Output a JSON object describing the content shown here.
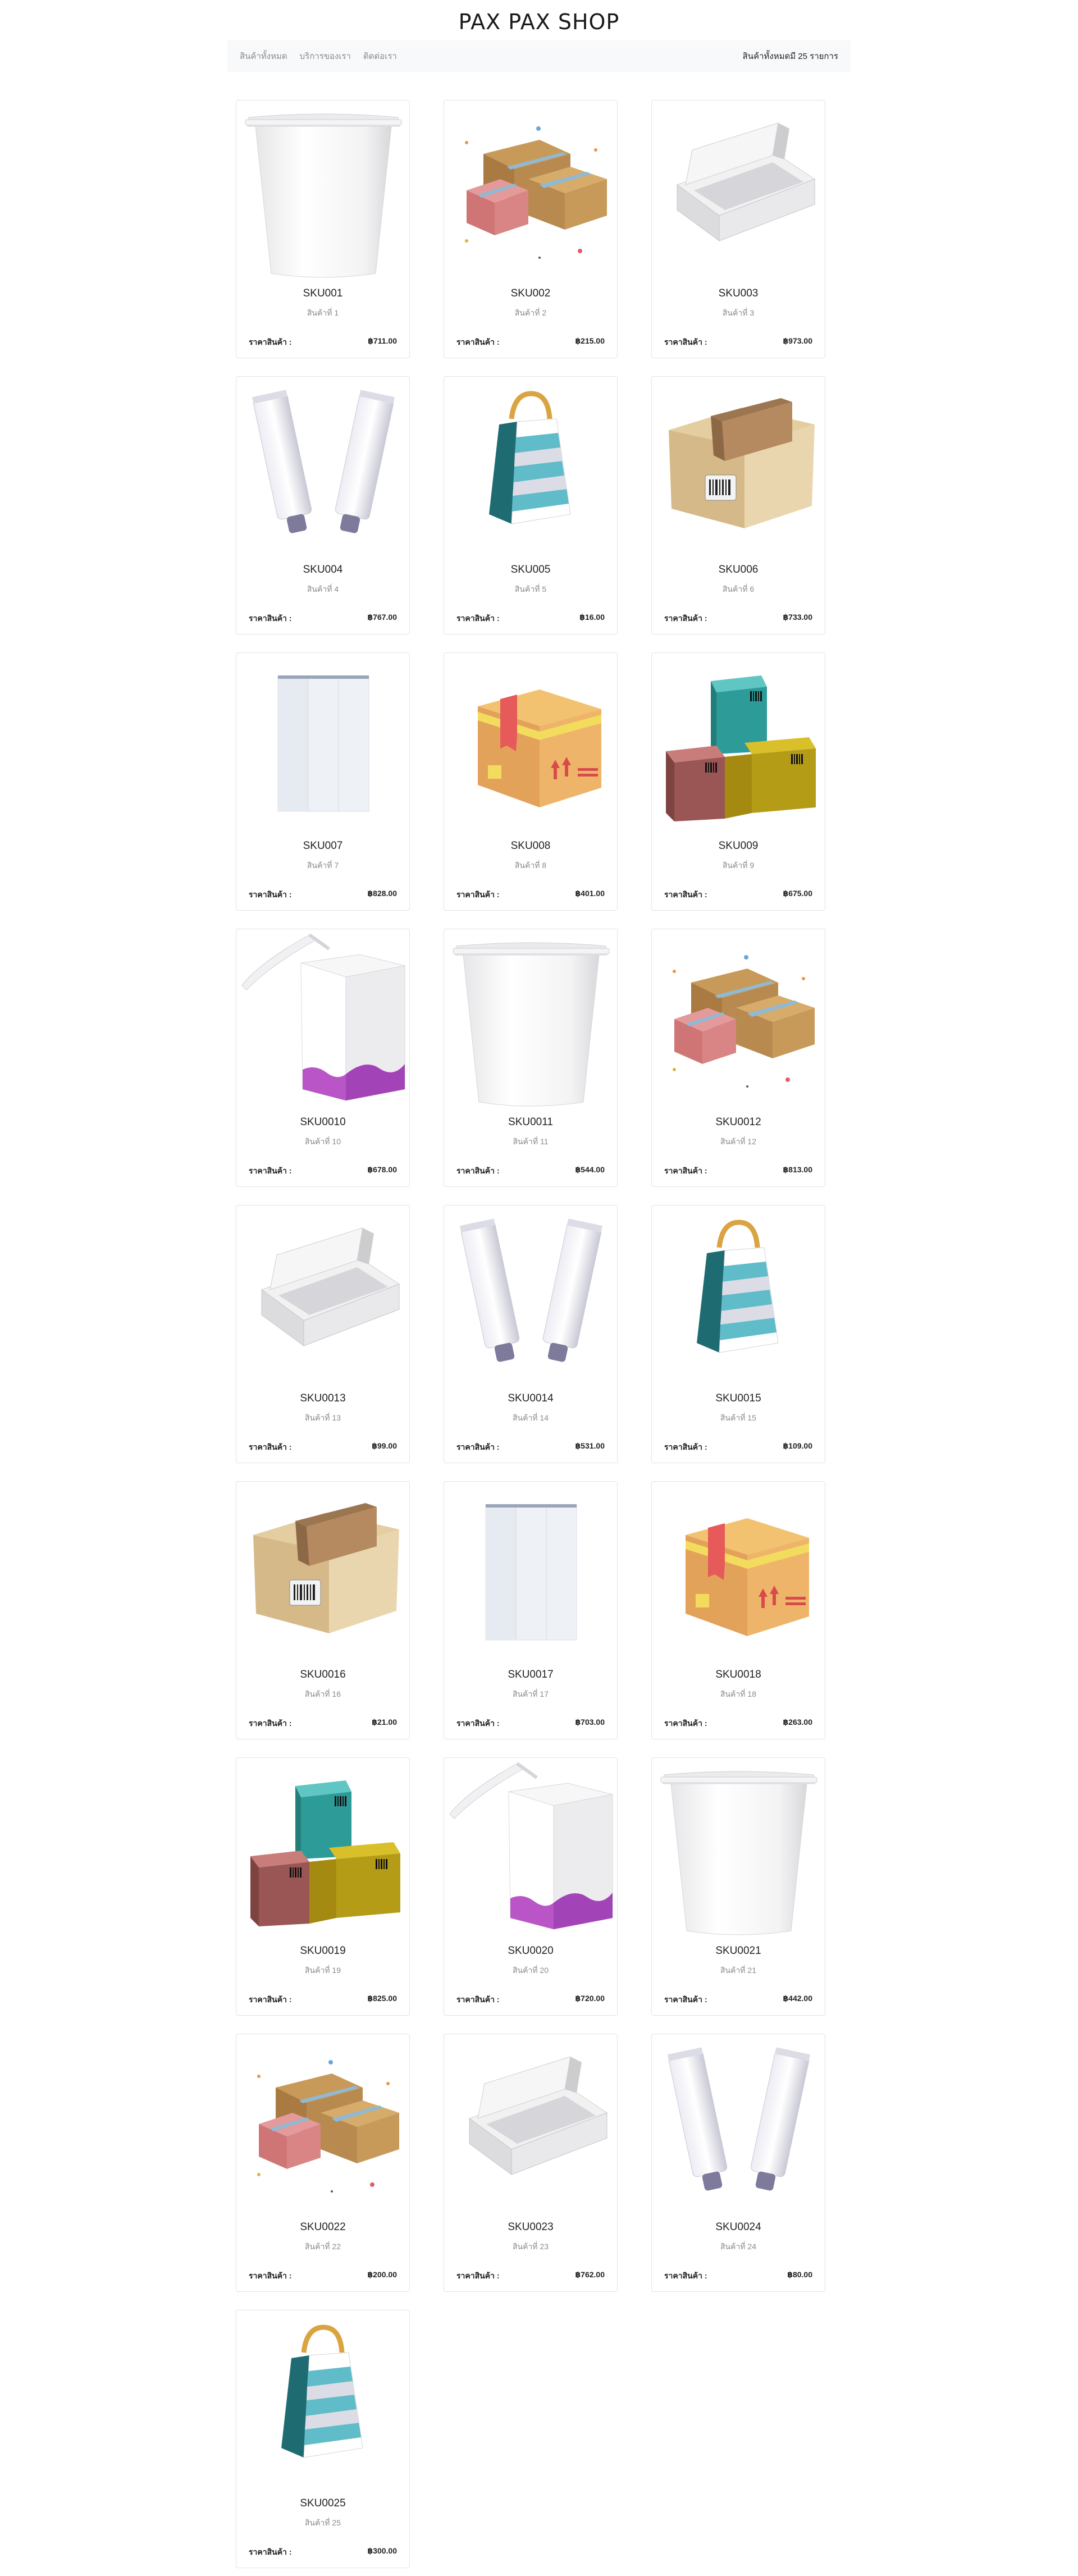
{
  "site": {
    "title": "PAX PAX SHOP"
  },
  "nav": {
    "links": [
      "สินค้าทั้งหมด",
      "บริการของเรา",
      "ติดต่อเรา"
    ],
    "total_text": "สินค้าทั้งหมดมี 25 รายการ"
  },
  "price_label": "ราคาสินค้า :",
  "products": [
    {
      "sku": "SKU001",
      "name": "สินค้าที่ 1",
      "price": "฿711.00",
      "image": "paper-cup"
    },
    {
      "sku": "SKU002",
      "name": "สินค้าที่ 2",
      "price": "฿215.00",
      "image": "parcel-boxes"
    },
    {
      "sku": "SKU003",
      "name": "สินค้าที่ 3",
      "price": "฿973.00",
      "image": "open-white-box"
    },
    {
      "sku": "SKU004",
      "name": "สินค้าที่ 4",
      "price": "฿767.00",
      "image": "tubes"
    },
    {
      "sku": "SKU005",
      "name": "สินค้าที่ 5",
      "price": "฿16.00",
      "image": "shopping-bag"
    },
    {
      "sku": "SKU006",
      "name": "สินค้าที่ 6",
      "price": "฿733.00",
      "image": "cardboard-box-barcode"
    },
    {
      "sku": "SKU007",
      "name": "สินค้าที่ 7",
      "price": "฿828.00",
      "image": "white-carton"
    },
    {
      "sku": "SKU008",
      "name": "สินค้าที่ 8",
      "price": "฿401.00",
      "image": "shipping-box"
    },
    {
      "sku": "SKU009",
      "name": "สินค้าที่ 9",
      "price": "฿675.00",
      "image": "stacked-colored-boxes"
    },
    {
      "sku": "SKU0010",
      "name": "สินค้าที่ 10",
      "price": "฿678.00",
      "image": "juice-box"
    },
    {
      "sku": "SKU0011",
      "name": "สินค้าที่ 11",
      "price": "฿544.00",
      "image": "paper-cup"
    },
    {
      "sku": "SKU0012",
      "name": "สินค้าที่ 12",
      "price": "฿813.00",
      "image": "parcel-boxes"
    },
    {
      "sku": "SKU0013",
      "name": "สินค้าที่ 13",
      "price": "฿99.00",
      "image": "open-white-box"
    },
    {
      "sku": "SKU0014",
      "name": "สินค้าที่ 14",
      "price": "฿531.00",
      "image": "tubes"
    },
    {
      "sku": "SKU0015",
      "name": "สินค้าที่ 15",
      "price": "฿109.00",
      "image": "shopping-bag"
    },
    {
      "sku": "SKU0016",
      "name": "สินค้าที่ 16",
      "price": "฿21.00",
      "image": "cardboard-box-barcode"
    },
    {
      "sku": "SKU0017",
      "name": "สินค้าที่ 17",
      "price": "฿703.00",
      "image": "white-carton"
    },
    {
      "sku": "SKU0018",
      "name": "สินค้าที่ 18",
      "price": "฿263.00",
      "image": "shipping-box"
    },
    {
      "sku": "SKU0019",
      "name": "สินค้าที่ 19",
      "price": "฿825.00",
      "image": "stacked-colored-boxes"
    },
    {
      "sku": "SKU0020",
      "name": "สินค้าที่ 20",
      "price": "฿720.00",
      "image": "juice-box"
    },
    {
      "sku": "SKU0021",
      "name": "สินค้าที่ 21",
      "price": "฿442.00",
      "image": "paper-cup"
    },
    {
      "sku": "SKU0022",
      "name": "สินค้าที่ 22",
      "price": "฿200.00",
      "image": "parcel-boxes"
    },
    {
      "sku": "SKU0023",
      "name": "สินค้าที่ 23",
      "price": "฿762.00",
      "image": "open-white-box"
    },
    {
      "sku": "SKU0024",
      "name": "สินค้าที่ 24",
      "price": "฿80.00",
      "image": "tubes"
    },
    {
      "sku": "SKU0025",
      "name": "สินค้าที่ 25",
      "price": "฿300.00",
      "image": "shopping-bag"
    }
  ]
}
